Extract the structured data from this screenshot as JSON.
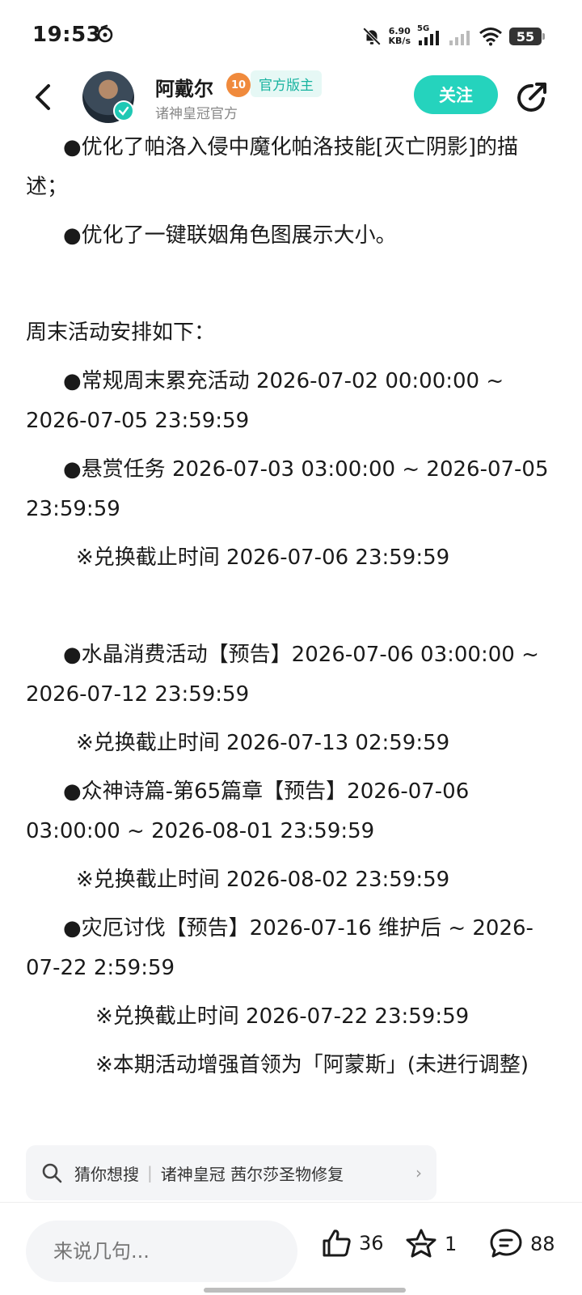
{
  "status_bar": {
    "time": "19:53",
    "net_speed": "6.90",
    "net_unit": "KB/s",
    "network": "5G",
    "battery": "55"
  },
  "header": {
    "author_name": "阿戴尔",
    "level_badge": "10",
    "role_badge": "官方版主",
    "author_subtitle": "诸神皇冠官方",
    "follow_label": "关注"
  },
  "content": {
    "lines": [
      {
        "text": "●优化了帕洛入侵中魔化帕洛技能[灭亡阴影]的描述；",
        "indent": 1
      },
      {
        "text": "●优化了一键联姻角色图展示大小。",
        "indent": 1
      },
      {
        "text": "",
        "indent": 0
      },
      {
        "text": "周末活动安排如下：",
        "indent": 0
      },
      {
        "text": "●常规周末累充活动 2026-07-02 00:00:00 ~ 2026-07-05 23:59:59",
        "indent": 1
      },
      {
        "text": "●悬赏任务 2026-07-03 03:00:00 ~ 2026-07-05 23:59:59",
        "indent": 1
      },
      {
        "text": "※兑换截止时间 2026-07-06 23:59:59",
        "indent": 2
      },
      {
        "text": "",
        "indent": 0
      },
      {
        "text": "●水晶消费活动【预告】2026-07-06 03:00:00 ~ 2026-07-12 23:59:59",
        "indent": 1
      },
      {
        "text": "※兑换截止时间 2026-07-13 02:59:59",
        "indent": 2
      },
      {
        "text": "●众神诗篇-第65篇章【预告】2026-07-06 03:00:00 ~ 2026-08-01 23:59:59",
        "indent": 1
      },
      {
        "text": "※兑换截止时间 2026-08-02 23:59:59",
        "indent": 2
      },
      {
        "text": "●灾厄讨伐【预告】2026-07-16 维护后 ~ 2026-07-22 2:59:59",
        "indent": 1
      },
      {
        "text": "※兑换截止时间 2026-07-22 23:59:59",
        "indent": 3
      },
      {
        "text": "※本期活动增强首领为「阿蒙斯」(未进行调整)",
        "indent": 3
      }
    ]
  },
  "search_suggest": {
    "label": "猜你想搜",
    "query": "诸神皇冠 茜尔莎圣物修复"
  },
  "bottom_bar": {
    "comment_placeholder": "来说几句...",
    "likes": "36",
    "favorites": "1",
    "comments": "88"
  },
  "colors": {
    "accent": "#25d3bd",
    "badge_text": "#18b3a0",
    "level_badge": "#f08a3c"
  }
}
